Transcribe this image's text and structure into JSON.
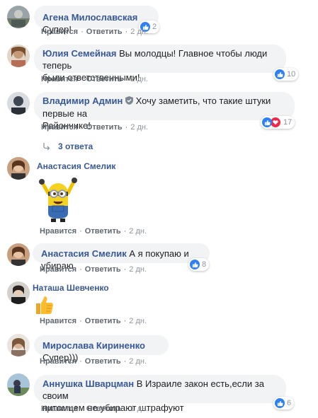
{
  "common": {
    "like_label": "Нравится",
    "reply_label": "Ответить",
    "separator": "·"
  },
  "comments": [
    {
      "author": "Агена Милославская",
      "text": "Супер!",
      "time": "2 дн.",
      "reactions": "2"
    },
    {
      "author": "Юлия Семейная",
      "text": "Вы молодцы! Главное чтобы люди теперь",
      "text2": "были ответственными!",
      "time": "2 дн.",
      "reactions": "10"
    },
    {
      "author": "Владимир Админ",
      "text": "Хочу заметить, что такие штуки первые на",
      "text2": "Райончике!",
      "time": "2 дн.",
      "reactions": "17"
    },
    {
      "author": "Анастасия Смелик",
      "time": "2 дн."
    },
    {
      "author": "Анастасия Смелик",
      "text": "А я покупаю и убираю",
      "time": "2 дн.",
      "reactions": "8"
    },
    {
      "author": "Наташа Шевченко",
      "time": "2 дн."
    },
    {
      "author": "Мирослава Кириненко",
      "text": "Супер)))",
      "time": "2 дн."
    },
    {
      "author": "Аннушка Шварцман",
      "text": "В Израиле закон есть,если за своим",
      "text2": "питомцем не убирают штрафуют",
      "time": "1 дн.",
      "reactions": "6"
    }
  ],
  "replies_link": "3 ответа",
  "colors": {
    "link": "#385898",
    "bubble": "#f2f3f5",
    "like": "#2e81f4",
    "love": "#f0284a"
  }
}
